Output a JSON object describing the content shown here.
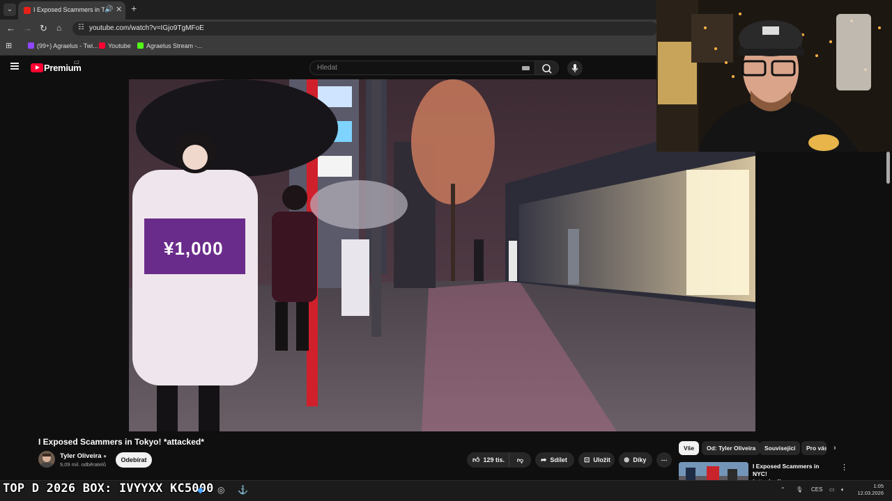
{
  "browser": {
    "tab_title": "I Exposed Scammers in Tokyo",
    "url": "youtube.com/watch?v=IGjo9TgMFoE",
    "bookmarks": [
      {
        "label": "(99+) Agraelus - Twi...",
        "color": "#9146ff"
      },
      {
        "label": "Youtube",
        "color": "#ff0033"
      },
      {
        "label": "Agraelus Stream -...",
        "color": "#53fc18"
      }
    ],
    "colors": {
      "tab_bg": "#3b3b3b",
      "toolbar_bg": "#3b3b3b"
    }
  },
  "youtube": {
    "brand": "Premium",
    "region": "CZ",
    "search_placeholder": "Hledat",
    "video": {
      "title": "I Exposed Scammers in Tokyo! *attacked*",
      "channel": "Tyler Oliveira",
      "verified_icon": "check-circle-icon",
      "subscribers": "9,09 mil. odběratelů",
      "subscribe_label": "Odebírat",
      "likes": "129 tis.",
      "share_label": "Sdílet",
      "save_label": "Uložit",
      "thanks_label": "Díky",
      "sign_text": "¥1,000"
    },
    "chips": [
      "Vše",
      "Od: Tyler Oliveira",
      "Související",
      "Pro vás"
    ],
    "recommendation": {
      "title_line1": "I Exposed Scammers in NYC!",
      "title_line2": "*attacked*"
    },
    "colors": {
      "bg": "#0f0f0f",
      "accent": "#ff0033",
      "pill": "#272727"
    }
  },
  "taskbar": {
    "promo_text": "TOP D 2026 BOX: IVYYXX KC5000",
    "language": "CES",
    "time": "1:05",
    "date": "12.03.2026"
  }
}
